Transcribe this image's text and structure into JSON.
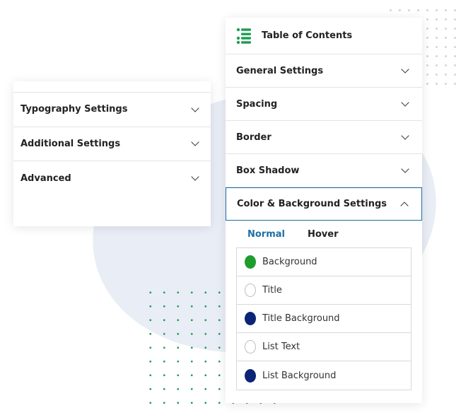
{
  "left_panel": {
    "items": [
      {
        "label": "Typography Settings"
      },
      {
        "label": "Additional Settings"
      },
      {
        "label": "Advanced"
      }
    ]
  },
  "right_panel": {
    "title": "Table of Contents",
    "icon": "list-icon",
    "accent_color": "#1d6fa5",
    "icon_color": "#1f9d55",
    "sections": [
      {
        "label": "General Settings",
        "expanded": false
      },
      {
        "label": "Spacing",
        "expanded": false
      },
      {
        "label": "Border",
        "expanded": false
      },
      {
        "label": "Box Shadow",
        "expanded": false
      },
      {
        "label": "Color & Background Settings",
        "expanded": true
      }
    ],
    "tabs": [
      {
        "label": "Normal",
        "active": true
      },
      {
        "label": "Hover",
        "active": false
      }
    ],
    "colors": [
      {
        "label": "Background",
        "color": "#1e9c2e"
      },
      {
        "label": "Title",
        "color": "#ffffff"
      },
      {
        "label": "Title Background",
        "color": "#0b2576"
      },
      {
        "label": "List Text",
        "color": "#ffffff"
      },
      {
        "label": "List Background",
        "color": "#0b2576"
      }
    ]
  }
}
